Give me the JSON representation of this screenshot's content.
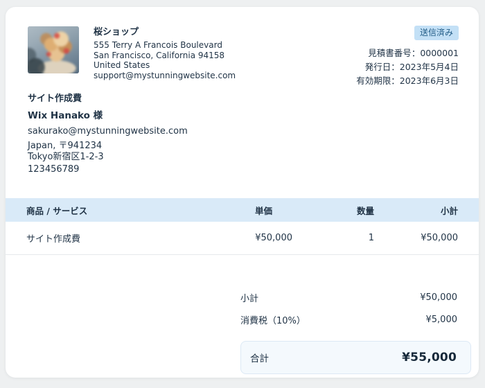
{
  "header": {
    "company": {
      "name": "桜ショップ",
      "address_lines": [
        "555 Terry A Francois Boulevard",
        "San Francisco, California 94158",
        "United States",
        "support@mystunningwebsite.com"
      ]
    },
    "status_badge": "送信済み",
    "meta_separator": "：",
    "meta": [
      {
        "label": "見積書番号",
        "value": "0000001"
      },
      {
        "label": "発行日",
        "value": "2023年5月4日"
      },
      {
        "label": "有効期限",
        "value": "2023年6月3日"
      }
    ]
  },
  "project_title": "サイト作成費",
  "customer": {
    "name": "Wix Hanako 様",
    "email": "sakurako@mystunningwebsite.com",
    "address_lines": [
      "Japan, 〒941234",
      "Tokyo新宿区1-2-3"
    ],
    "phone": "123456789"
  },
  "items_table": {
    "columns": [
      "商品 / サービス",
      "単価",
      "数量",
      "小計"
    ],
    "rows": [
      {
        "name": "サイト作成費",
        "unit_price": "¥50,000",
        "quantity": "1",
        "amount": "¥50,000"
      }
    ]
  },
  "totals": {
    "rows": [
      {
        "label": "小計",
        "value": "¥50,000"
      },
      {
        "label": "消費税（10%）",
        "value": "¥5,000"
      }
    ],
    "total": {
      "label": "合計",
      "value": "¥55,000"
    }
  },
  "colors": {
    "page_background": "#eef0f1",
    "table_header_bg": "#d9eaf8",
    "badge_bg": "#c3e0f6",
    "badge_text": "#235d87",
    "total_box_bg": "#f4f9fd",
    "total_box_border": "#dce9f5",
    "text_primary": "#1f3245"
  }
}
